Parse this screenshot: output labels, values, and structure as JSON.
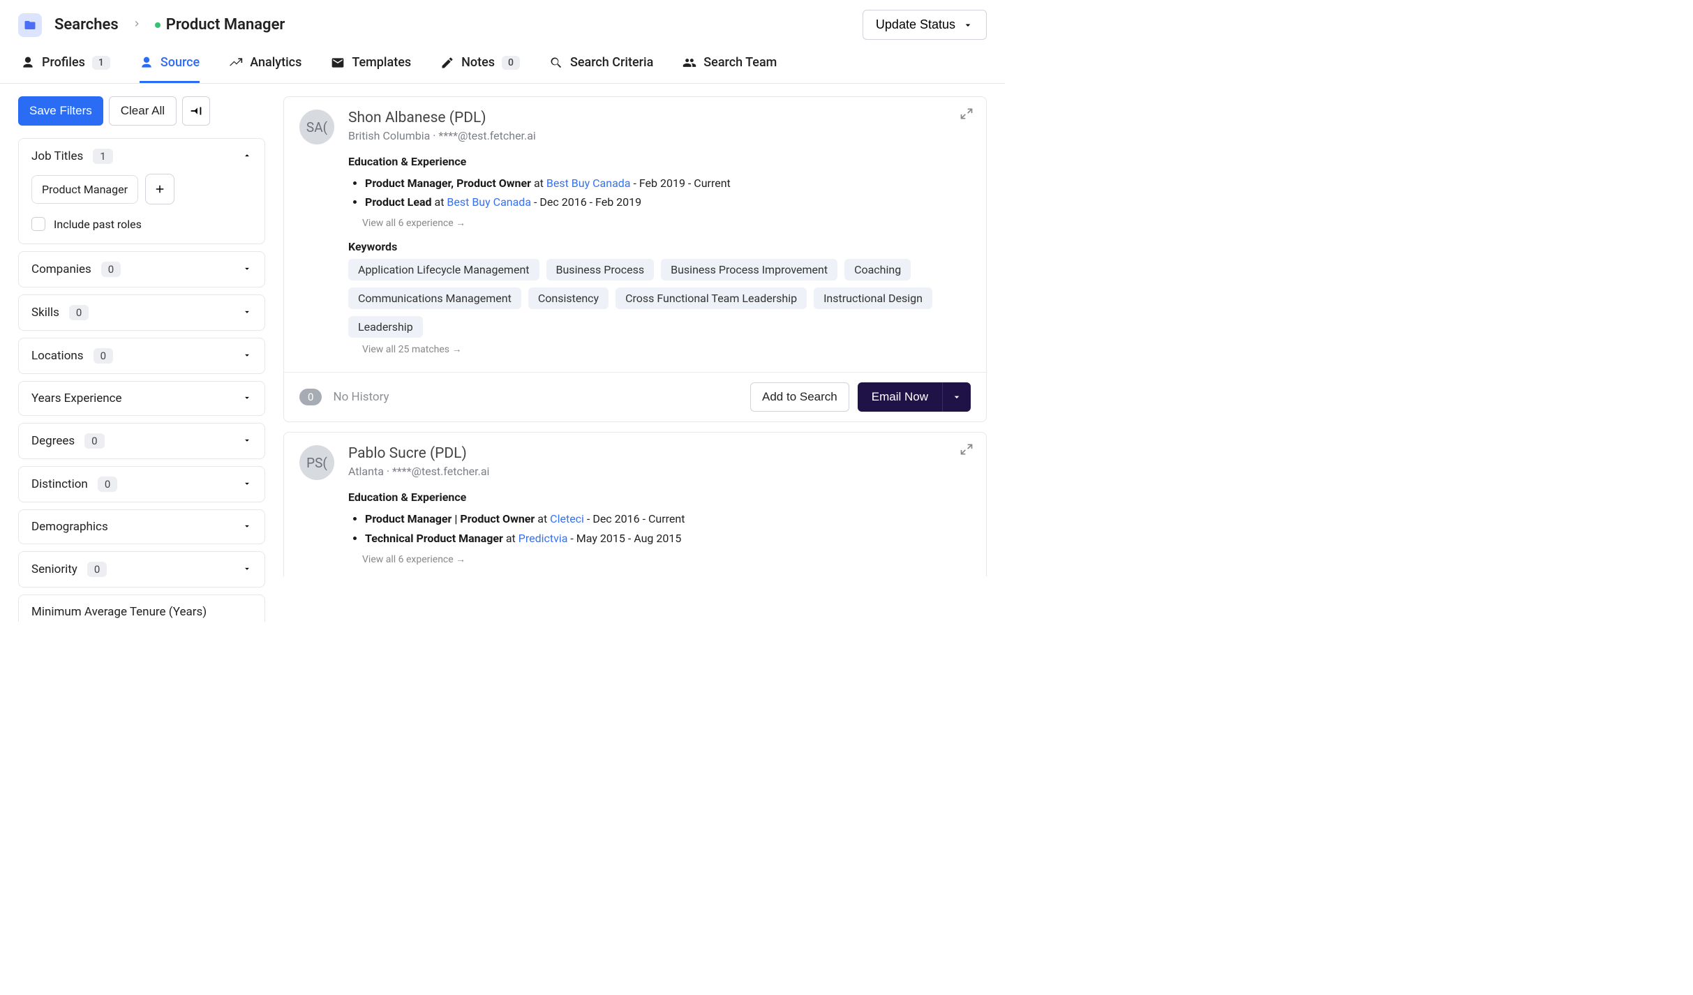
{
  "header": {
    "breadcrumb_root": "Searches",
    "breadcrumb_current": "Product Manager",
    "update_status_label": "Update Status"
  },
  "tabs": {
    "profiles": {
      "label": "Profiles",
      "badge": "1"
    },
    "source": {
      "label": "Source"
    },
    "analytics": {
      "label": "Analytics"
    },
    "templates": {
      "label": "Templates"
    },
    "notes": {
      "label": "Notes",
      "badge": "0"
    },
    "criteria": {
      "label": "Search Criteria"
    },
    "team": {
      "label": "Search Team"
    }
  },
  "filters": {
    "save_label": "Save Filters",
    "clear_label": "Clear All",
    "panels": {
      "job_titles": {
        "title": "Job Titles",
        "count": "1",
        "chip": "Product Manager",
        "include_past_label": "Include past roles"
      },
      "companies": {
        "title": "Companies",
        "count": "0"
      },
      "skills": {
        "title": "Skills",
        "count": "0"
      },
      "locations": {
        "title": "Locations",
        "count": "0"
      },
      "years_exp": {
        "title": "Years Experience"
      },
      "degrees": {
        "title": "Degrees",
        "count": "0"
      },
      "distinction": {
        "title": "Distinction",
        "count": "0"
      },
      "demographics": {
        "title": "Demographics"
      },
      "seniority": {
        "title": "Seniority",
        "count": "0"
      },
      "min_tenure": {
        "title": "Minimum Average Tenure (Years)"
      }
    }
  },
  "cards": [
    {
      "initials": "SA(",
      "name": "Shon Albanese (PDL)",
      "subline": "British Columbia · ****@test.fetcher.ai",
      "edu_title": "Education & Experience",
      "experience": [
        {
          "role": "Product Manager, Product Owner",
          "at": " at ",
          "company": "Best Buy Canada",
          "dates": " - Feb 2019 - Current"
        },
        {
          "role": "Product Lead",
          "at": " at ",
          "company": "Best Buy Canada",
          "dates": " - Dec 2016 - Feb 2019"
        }
      ],
      "view_all_exp": "View all 6 experience →",
      "keywords_title": "Keywords",
      "keywords": [
        "Application Lifecycle Management",
        "Business Process",
        "Business Process Improvement",
        "Coaching",
        "Communications Management",
        "Consistency",
        "Cross Functional Team Leadership",
        "Instructional Design",
        "Leadership"
      ],
      "view_all_kw": "View all 25 matches →",
      "history_count": "0",
      "history_text": "No History",
      "add_label": "Add to Search",
      "email_label": "Email Now"
    },
    {
      "initials": "PS(",
      "name": "Pablo Sucre (PDL)",
      "subline": "Atlanta · ****@test.fetcher.ai",
      "edu_title": "Education & Experience",
      "experience": [
        {
          "role": "Product Manager | Product Owner",
          "at": " at ",
          "company": "Cleteci",
          "dates": " - Dec 2016 - Current"
        },
        {
          "role": "Technical Product Manager",
          "at": " at ",
          "company": "Predictvia",
          "dates": " - May 2015 - Aug 2015"
        }
      ],
      "view_all_exp": "View all 6 experience →"
    }
  ]
}
